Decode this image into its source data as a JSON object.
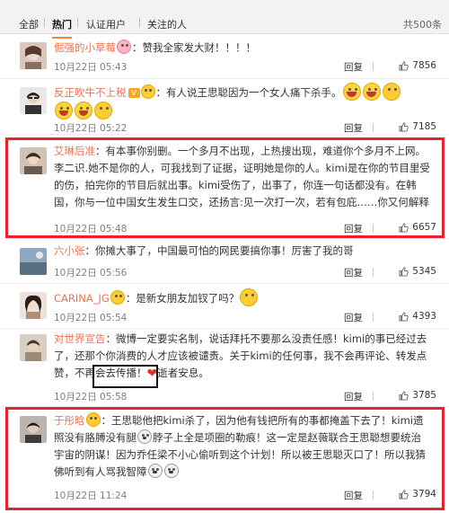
{
  "tabs": {
    "all": "全部",
    "hot": "热门",
    "verified": "认证用户",
    "following": "关注的人",
    "total": "共500条"
  },
  "colors": {
    "username": "#eb7350",
    "highlight_box": "#e8232e",
    "tab_active_underline": "#f7862a"
  },
  "comments": [
    {
      "user": "倔强的小草莓",
      "badge": "",
      "text": "：赞我全家发大财！！！！",
      "time": "10月22日 05:43",
      "reply": "回复",
      "likes": "7856"
    },
    {
      "user": "反正吹牛不上税",
      "badge": "V",
      "text": "：有人说王思聪因为一个女人痛下杀手。",
      "time": "10月22日 05:22",
      "reply": "回复",
      "likes": "7185"
    },
    {
      "user": "艾琳后准",
      "badge": "",
      "text": "：有本事你别删。一个多月不出现，上热搜出现，难道你个多月不上网。李二识.她不是你的人，可我找到了证据，证明她是你的人。kimi是在你的节目里受的伤，拍完你的节目后就出事。kimi受伤了，出事了，你连一句话都没有。在韩国，你与一位中国女生发生口交，还扬言:见一次打一次，若有包庇……你又何解释",
      "time": "10月22日 05:48",
      "reply": "回复",
      "likes": "6657"
    },
    {
      "user": "六小张",
      "badge": "",
      "text": "：你摊大事了，中国最可怕的网民要搞你事！厉害了我的哥",
      "time": "10月22日 05:56",
      "reply": "回复",
      "likes": "5345"
    },
    {
      "user": "CARINA_JG",
      "badge": "",
      "text": "：是新女朋友加钗了吗？",
      "time": "10月22日 05:54",
      "reply": "回复",
      "likes": "4393"
    },
    {
      "user": "对世界宣告",
      "badge": "",
      "text": "：微博一定要实名制，说话拜托不要那么没责任感！kimi的事已经过去了，还那个你消费的人才应该被谴责。关于kimi的任何事，我不会再评论、转发点赞，不再会去传播！",
      "text_end": "逝者安息。",
      "time": "10月22日 05:58",
      "reply": "回复",
      "likes": "3785"
    },
    {
      "user": "于彤晗",
      "badge": "",
      "text_a": "：王思聪他把kimi杀了，因为他有钱把所有的事都掩盖下去了！kimi遗照没有胳膊没有腿",
      "text_b": "脖子上全是项圈的勒痕！这一定是赵薇联合王思聪想要统治宇宙的阴谋！因为乔任梁不小心偷听到这个计划！所以被王思聪灭口了！所以我猜佛听到有人骂我智障",
      "time": "10月22日 11:24",
      "reply": "回复",
      "likes": "3794"
    }
  ],
  "icons": {
    "like": "thumb-up-icon",
    "emoji_pray": "pray-emoji",
    "emoji_laugh": "laugh-emoji",
    "emoji_dog": "doge-emoji",
    "emoji_pig": "pig-emoji",
    "heart": "heart-icon",
    "vip": "vip-badge"
  }
}
